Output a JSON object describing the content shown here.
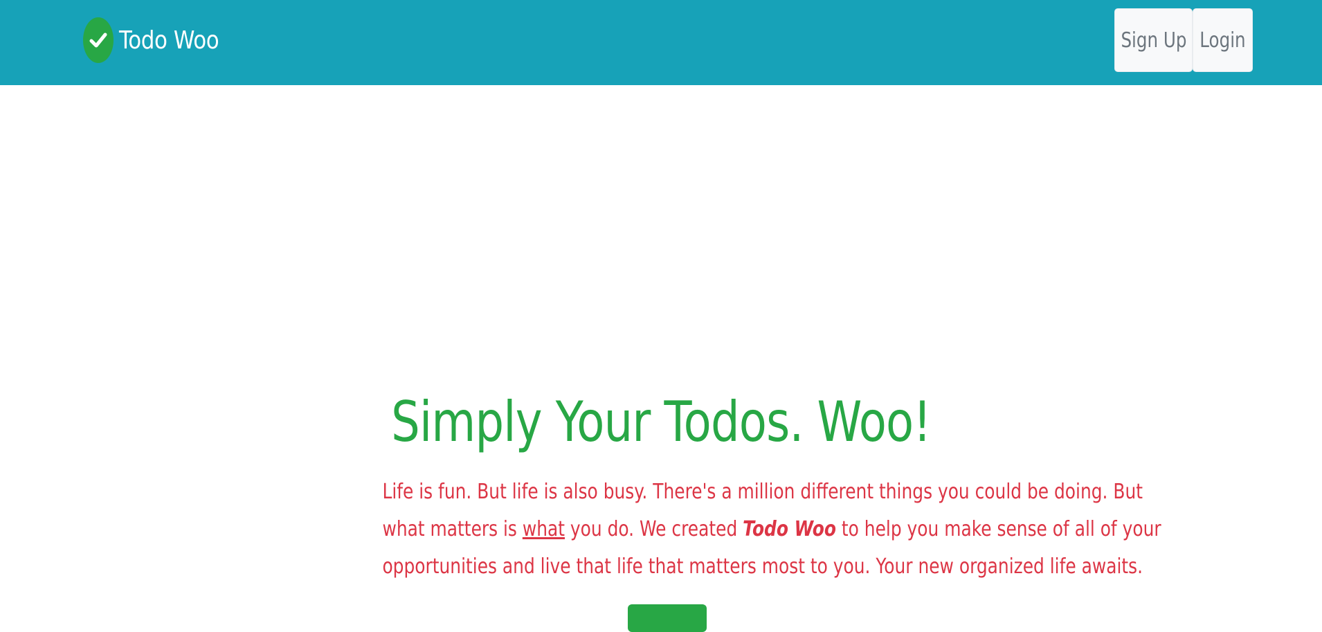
{
  "navbar": {
    "brand_text": "Todo Woo",
    "signup_label": "Sign Up",
    "login_label": "Login"
  },
  "hero": {
    "title": "Simply Your Todos. Woo!",
    "lead": {
      "line1": "Life is fun. But life is also busy. There's a million different things you could be doing. But",
      "line2_before": "what matters is ",
      "line2_emphasis": "what",
      "line2_middle": " you do. We created ",
      "line2_brand": "Todo Woo",
      "line2_after": " to help you make sense of all of your",
      "line3": "opportunities and live that life that matters most to you. Your new organized life awaits."
    }
  },
  "colors": {
    "navbar_bg": "#17a2b8",
    "accent_green": "#28a745",
    "lead_red": "#dc3545",
    "button_light": "#f8f9fa",
    "button_text": "#6c757d"
  },
  "icons": {
    "brand_logo": "check-circle-icon"
  }
}
